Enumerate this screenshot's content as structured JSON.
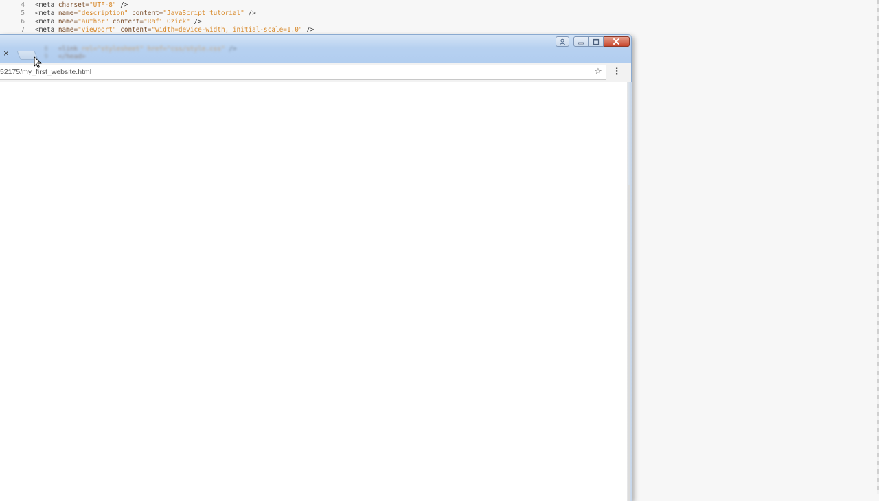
{
  "editor": {
    "lines": [
      {
        "num": "4",
        "parts": [
          {
            "t": "<meta ",
            "c": ""
          },
          {
            "t": "charset=",
            "c": "attr"
          },
          {
            "t": "\"UTF-8\"",
            "c": "str"
          },
          {
            "t": " />",
            "c": ""
          }
        ]
      },
      {
        "num": "5",
        "parts": [
          {
            "t": "<meta ",
            "c": ""
          },
          {
            "t": "name=",
            "c": "attr"
          },
          {
            "t": "\"description\"",
            "c": "str"
          },
          {
            "t": " content=",
            "c": "attr"
          },
          {
            "t": "\"JavaScript tutorial\"",
            "c": "str"
          },
          {
            "t": " />",
            "c": ""
          }
        ]
      },
      {
        "num": "6",
        "parts": [
          {
            "t": "<meta ",
            "c": ""
          },
          {
            "t": "name=",
            "c": "attr"
          },
          {
            "t": "\"author\"",
            "c": "str"
          },
          {
            "t": " content=",
            "c": "attr"
          },
          {
            "t": "\"Rafi Ozick\"",
            "c": "str"
          },
          {
            "t": " />",
            "c": ""
          }
        ]
      },
      {
        "num": "7",
        "parts": [
          {
            "t": "<meta ",
            "c": ""
          },
          {
            "t": "name=",
            "c": "attr"
          },
          {
            "t": "\"viewport\"",
            "c": "str"
          },
          {
            "t": " content=",
            "c": "attr"
          },
          {
            "t": "\"width=device-width, initial-scale=1.0\"",
            "c": "str"
          },
          {
            "t": " />",
            "c": ""
          }
        ]
      }
    ]
  },
  "browser": {
    "tab": {
      "close_glyph": "×"
    },
    "address_bar": {
      "url": "52175/my_first_website.html"
    },
    "bookmark_glyph": "☆",
    "menu_glyph": "⋮"
  },
  "colors": {
    "titlebar": "#b7d1f0",
    "close_button": "#c7452b",
    "code_string": "#d88a2c",
    "code_attr": "#7a4e2b"
  },
  "icons": {
    "bookmark": "star-icon",
    "menu": "more-vert-icon",
    "close_tab": "close-icon",
    "user": "user-icon",
    "minimize": "minimize-icon",
    "maximize": "maximize-icon",
    "window_close": "window-close-icon",
    "cursor": "mouse-cursor-icon"
  }
}
